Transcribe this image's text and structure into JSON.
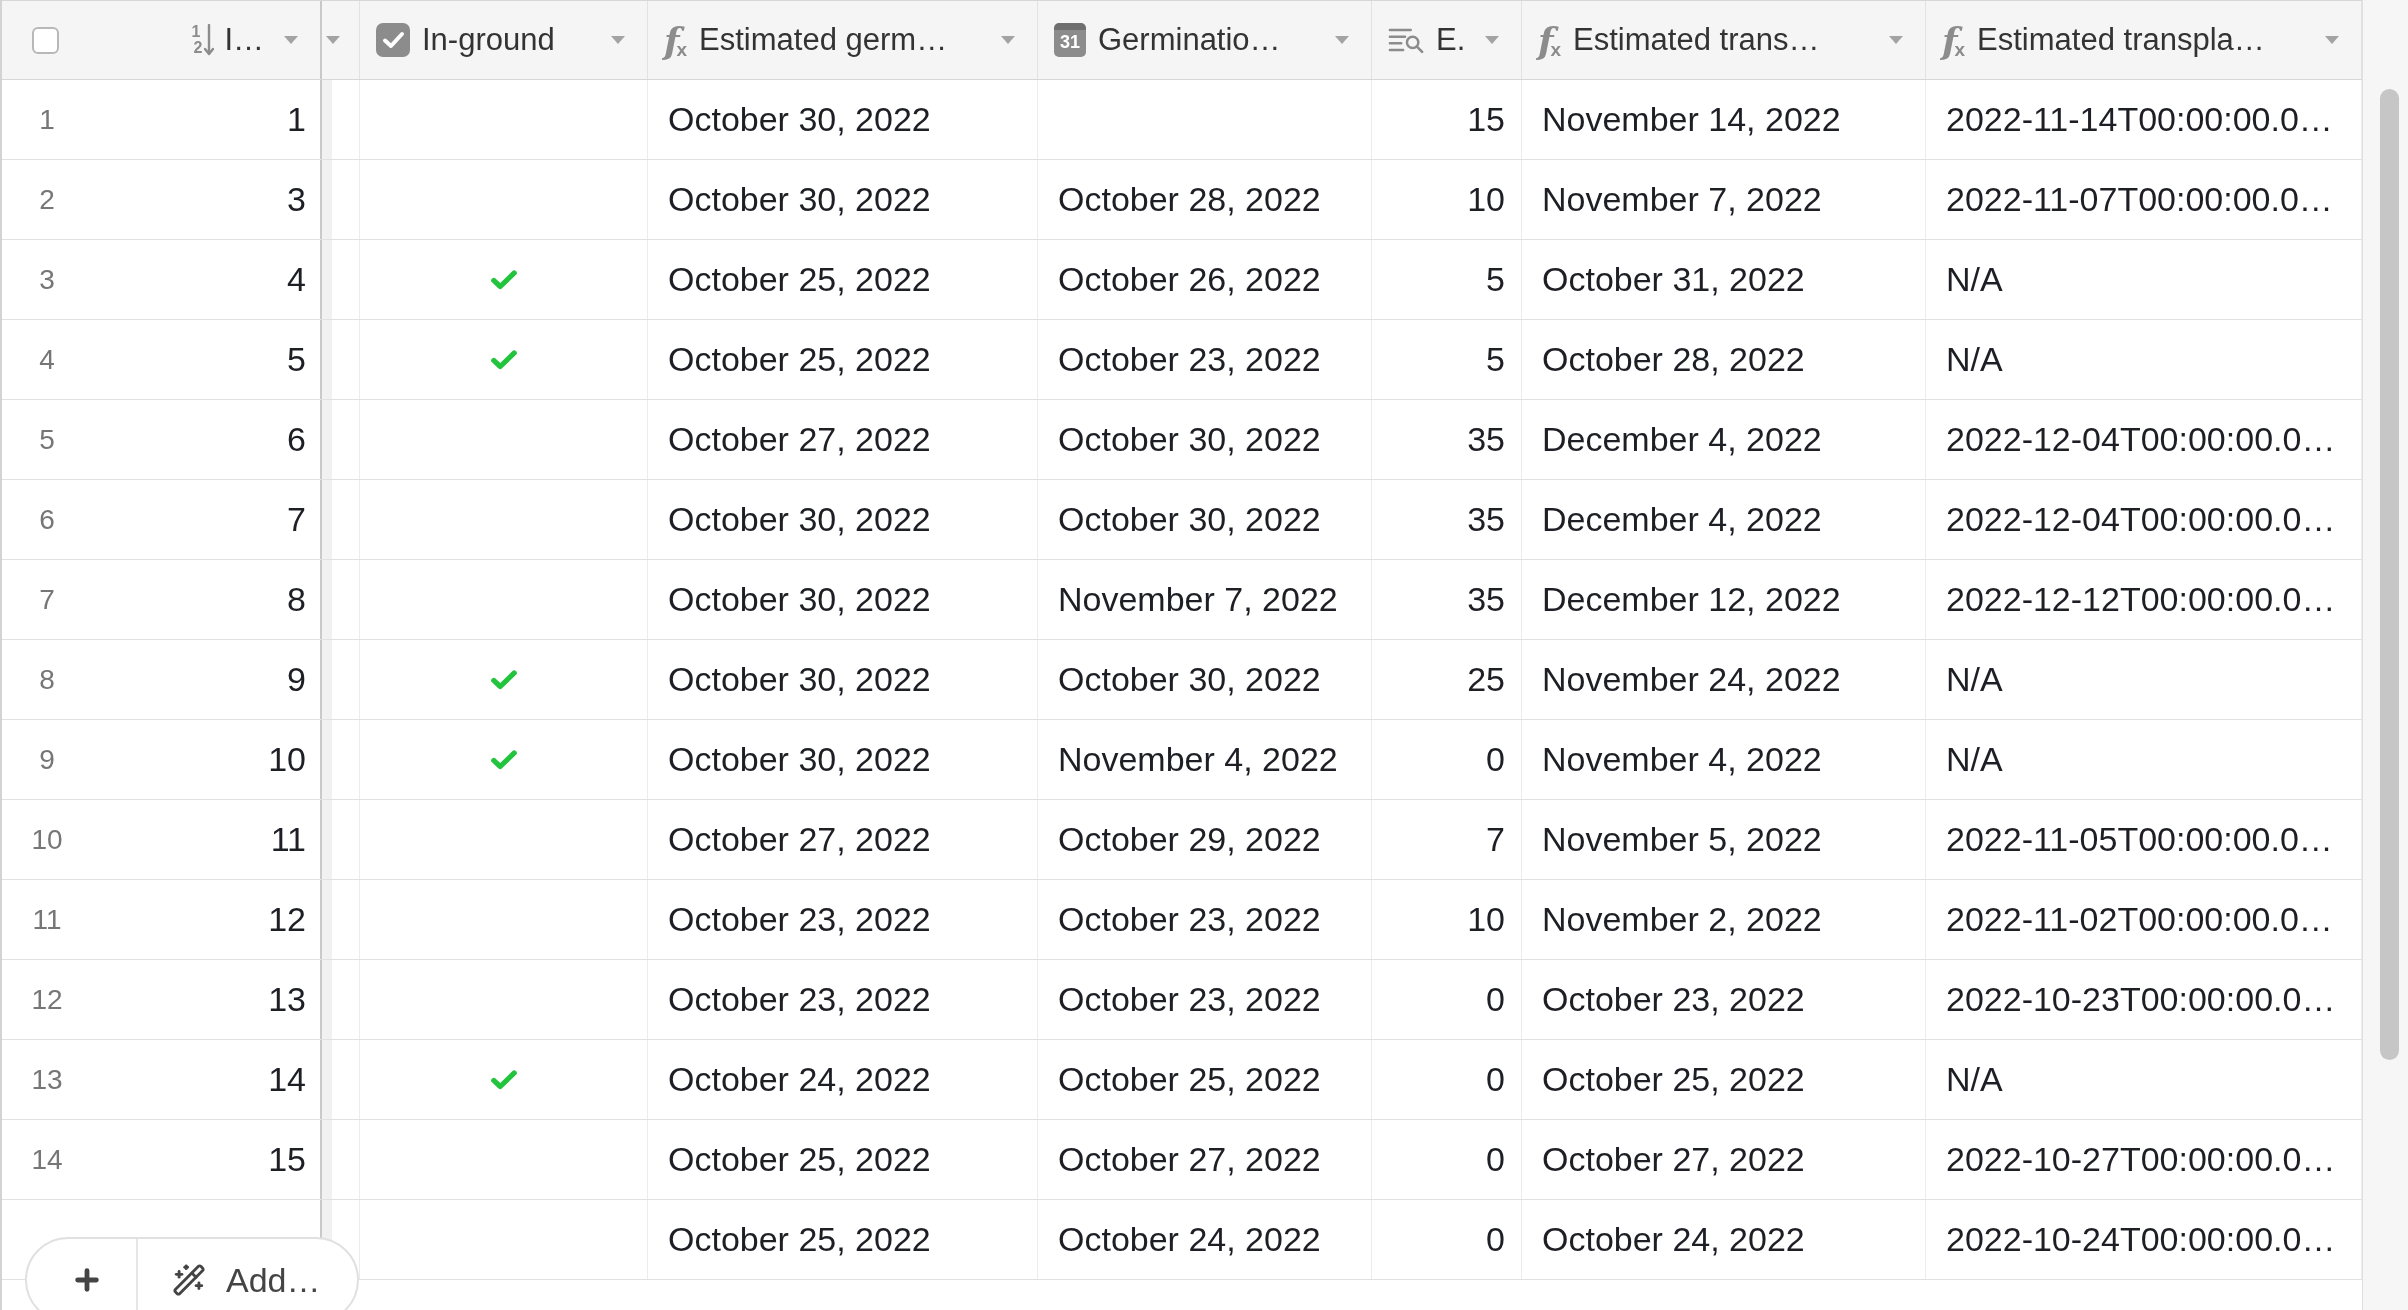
{
  "select_all": {
    "checked": false
  },
  "columns": [
    {
      "kind": "number",
      "label": "I…",
      "icon_text": [
        "1",
        "2"
      ]
    },
    {
      "kind": "checkbox",
      "label": "In-ground"
    },
    {
      "kind": "formula",
      "label": "Estimated germ…",
      "icon_text": [
        "f",
        "x"
      ]
    },
    {
      "kind": "date",
      "label": "Germinatio…",
      "icon_text": "31"
    },
    {
      "kind": "lookup",
      "label": "E."
    },
    {
      "kind": "formula",
      "label": "Estimated trans…",
      "icon_text": [
        "f",
        "x"
      ]
    },
    {
      "kind": "formula",
      "label": "Estimated transpla…",
      "icon_text": [
        "f",
        "x"
      ]
    }
  ],
  "rows": [
    {
      "row_number": "1",
      "column_1": "1",
      "in_ground": false,
      "column_3": "October 30, 2022",
      "column_5": "15",
      "column_6": "November 14, 2022",
      "column_7": "2022-11-14T00:00:00.0…"
    },
    {
      "row_number": "2",
      "column_1": "3",
      "in_ground": false,
      "column_3": "October 30, 2022",
      "column_4": "October 28, 2022",
      "column_5": "10",
      "column_6": "November 7, 2022",
      "column_7": "2022-11-07T00:00:00.0…"
    },
    {
      "row_number": "3",
      "column_1": "4",
      "in_ground": true,
      "column_3": "October 25, 2022",
      "column_4": "October 26, 2022",
      "column_5": "5",
      "column_6": "October 31, 2022",
      "column_7": "N/A"
    },
    {
      "row_number": "4",
      "column_1": "5",
      "in_ground": true,
      "column_3": "October 25, 2022",
      "column_4": "October 23, 2022",
      "column_5": "5",
      "column_6": "October 28, 2022",
      "column_7": "N/A"
    },
    {
      "row_number": "5",
      "column_1": "6",
      "in_ground": false,
      "column_3": "October 27, 2022",
      "column_4": "October 30, 2022",
      "column_5": "35",
      "column_6": "December 4, 2022",
      "column_7": "2022-12-04T00:00:00.0…"
    },
    {
      "row_number": "6",
      "column_1": "7",
      "in_ground": false,
      "column_3": "October 30, 2022",
      "column_4": "October 30, 2022",
      "column_5": "35",
      "column_6": "December 4, 2022",
      "column_7": "2022-12-04T00:00:00.0…"
    },
    {
      "row_number": "7",
      "column_1": "8",
      "in_ground": false,
      "column_3": "October 30, 2022",
      "column_4": "November 7, 2022",
      "column_5": "35",
      "column_6": "December 12, 2022",
      "column_7": "2022-12-12T00:00:00.0…"
    },
    {
      "row_number": "8",
      "column_1": "9",
      "in_ground": true,
      "column_3": "October 30, 2022",
      "column_4": "October 30, 2022",
      "column_5": "25",
      "column_6": "November 24, 2022",
      "column_7": "N/A"
    },
    {
      "row_number": "9",
      "column_1": "10",
      "in_ground": true,
      "column_3": "October 30, 2022",
      "column_4": "November 4, 2022",
      "column_5": "0",
      "column_6": "November 4, 2022",
      "column_7": "N/A"
    },
    {
      "row_number": "10",
      "column_1": "11",
      "in_ground": false,
      "column_3": "October 27, 2022",
      "column_4": "October 29, 2022",
      "column_5": "7",
      "column_6": "November 5, 2022",
      "column_7": "2022-11-05T00:00:00.0…"
    },
    {
      "row_number": "11",
      "column_1": "12",
      "in_ground": false,
      "column_3": "October 23, 2022",
      "column_4": "October 23, 2022",
      "column_5": "10",
      "column_6": "November 2, 2022",
      "column_7": "2022-11-02T00:00:00.0…"
    },
    {
      "row_number": "12",
      "column_1": "13",
      "in_ground": false,
      "column_3": "October 23, 2022",
      "column_4": "October 23, 2022",
      "column_5": "0",
      "column_6": "October 23, 2022",
      "column_7": "2022-10-23T00:00:00.0…"
    },
    {
      "row_number": "13",
      "column_1": "14",
      "in_ground": true,
      "column_3": "October 24, 2022",
      "column_4": "October 25, 2022",
      "column_5": "0",
      "column_6": "October 25, 2022",
      "column_7": "N/A"
    },
    {
      "row_number": "14",
      "column_1": "15",
      "in_ground": false,
      "column_3": "October 25, 2022",
      "column_4": "October 27, 2022",
      "column_5": "0",
      "column_6": "October 27, 2022",
      "column_7": "2022-10-27T00:00:00.0…"
    },
    {
      "in_ground": false,
      "column_3": "October 25, 2022",
      "column_4": "October 24, 2022",
      "column_5": "0",
      "column_6": "October 24, 2022",
      "column_7": "2022-10-24T00:00:00.0…"
    }
  ],
  "toolbar": {
    "add_label": "Add…"
  }
}
